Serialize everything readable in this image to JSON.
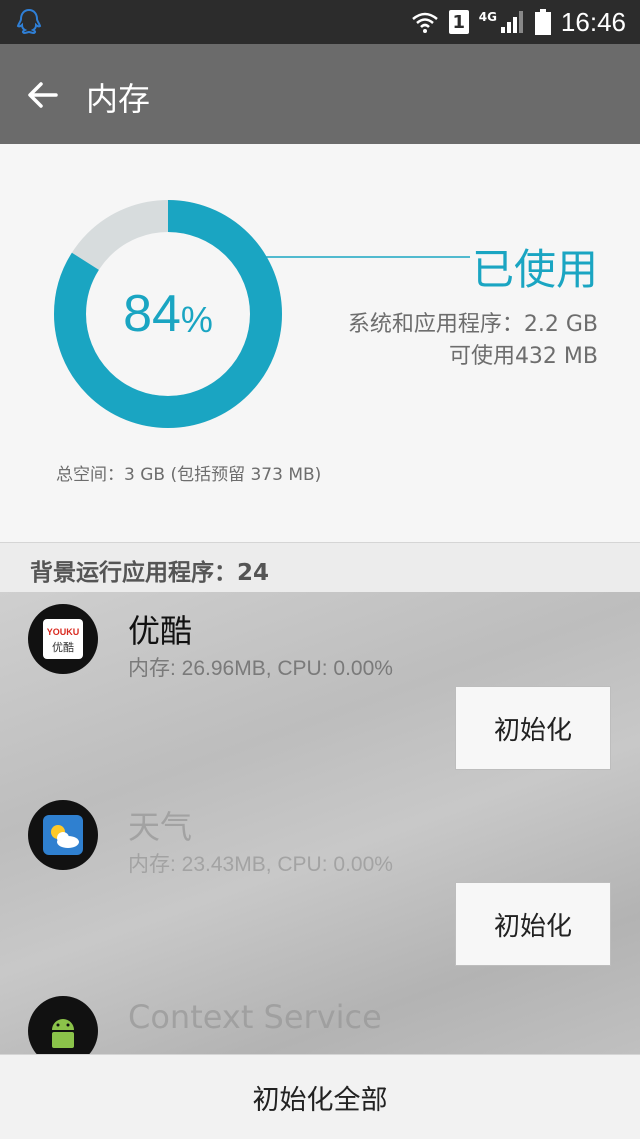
{
  "status_bar": {
    "time": "16:46",
    "network": "4G",
    "sim_slot": "1",
    "icons": [
      "qq-icon",
      "wifi-icon",
      "sim-icon",
      "signal-icon",
      "battery-icon"
    ]
  },
  "app_bar": {
    "title": "内存",
    "back_icon": "arrow-left-icon"
  },
  "memory": {
    "used_percent": 84,
    "percent_value": "84",
    "percent_sign": "%",
    "used_label": "已使用",
    "system_and_apps": "系统和应用程序：2.2 GB",
    "available": "可使用432 MB",
    "total_space": "总空间：3 GB (包括预留 373 MB)"
  },
  "background_apps": {
    "header": "背景运行应用程序：24",
    "items": [
      {
        "name": "优酷",
        "stats": "内存: 26.96MB, CPU: 0.00%",
        "button": "初始化",
        "icon": "youku-icon",
        "icon_text_1": "YOUKU",
        "icon_text_2": "优酷"
      },
      {
        "name": "天气",
        "stats": "内存: 23.43MB, CPU: 0.00%",
        "button": "初始化",
        "icon": "weather-icon"
      },
      {
        "name": "Context Service",
        "icon": "android-icon"
      }
    ]
  },
  "footer": {
    "reset_all": "初始化全部"
  },
  "colors": {
    "accent": "#1aa5c2",
    "ring_remaining": "#d7dcdd",
    "app_bar": "#6b6b6b",
    "status_bar": "#2c2c2c"
  }
}
